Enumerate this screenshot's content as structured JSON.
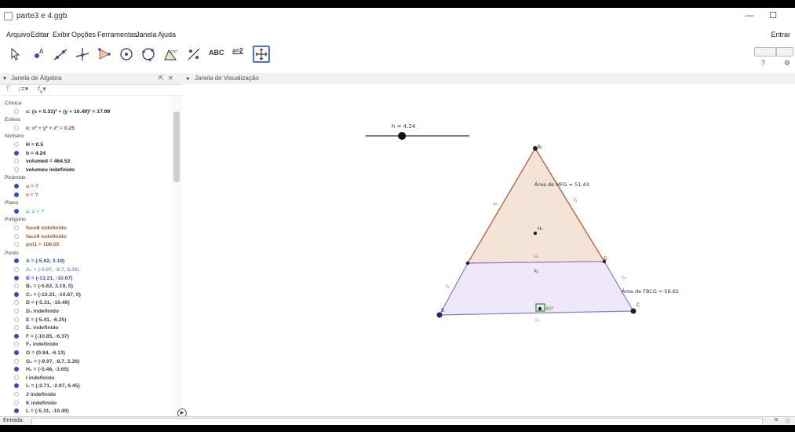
{
  "window": {
    "title": "parte3 e 4.ggb",
    "minimize": "—",
    "maximize": "☐"
  },
  "menu": {
    "items": [
      "Arquivo",
      "Editar",
      "Exibir",
      "Opções",
      "Ferramentas",
      "Janela",
      "Ajuda"
    ],
    "enter": "Entrar"
  },
  "toolbar": {
    "tools": [
      {
        "icon": "move-arrow-icon"
      },
      {
        "icon": "point-icon"
      },
      {
        "icon": "line-icon"
      },
      {
        "icon": "perpendicular-line-icon"
      },
      {
        "icon": "polygon-icon"
      },
      {
        "icon": "circle-center-point-icon"
      },
      {
        "icon": "circle-three-points-icon"
      },
      {
        "icon": "angle-icon"
      },
      {
        "icon": "reflect-icon"
      },
      {
        "icon": "text-icon",
        "label": "ABC"
      },
      {
        "icon": "slider-icon",
        "label": "a=2"
      },
      {
        "icon": "move-graphics-view-icon"
      }
    ],
    "help": "?",
    "active_index": 11
  },
  "algebra_view": {
    "header": "Janela de Álgebra",
    "rows": [
      {
        "type": "cat",
        "text": "Cônica"
      },
      {
        "type": "item",
        "dot": "hollow",
        "text": "c: (x + 5.31)² + (y + 10.49)² = 17.99",
        "color": "#222222"
      },
      {
        "type": "cat",
        "text": "Esfera"
      },
      {
        "type": "item",
        "dot": "hollow",
        "text": "e: x² + y² + z² = 0.25",
        "color": "#b13b2f"
      },
      {
        "type": "cat",
        "text": "Número"
      },
      {
        "type": "item",
        "dot": "hollow",
        "text": "H = 0.5",
        "color": "#222222"
      },
      {
        "type": "item",
        "dot": "filled",
        "text": "h = 4.24",
        "color": "#222222"
      },
      {
        "type": "item",
        "dot": "hollow",
        "text": "volumed = 464.52",
        "color": "#222222"
      },
      {
        "type": "item",
        "dot": "hollow",
        "text": "volumeu indefinido",
        "color": "#222222"
      },
      {
        "type": "cat",
        "text": "Pirâmide"
      },
      {
        "type": "item",
        "dot": "filled",
        "text": "u = ?",
        "color": "#b84b5c"
      },
      {
        "type": "item",
        "dot": "filled",
        "text": "v = ?",
        "color": "#b84b5c"
      },
      {
        "type": "cat",
        "text": "Plano"
      },
      {
        "type": "item",
        "dot": "filled",
        "text": "a: z = ?",
        "color": "#55b7d6"
      },
      {
        "type": "cat",
        "text": "Polígono"
      },
      {
        "type": "item",
        "dot": "hollow",
        "text": "face8 indefinido",
        "color": "#b3582f"
      },
      {
        "type": "item",
        "dot": "hollow",
        "text": "face9 indefinido",
        "color": "#b3582f"
      },
      {
        "type": "item",
        "dot": "hollow",
        "text": "pol1 = 108.05",
        "color": "#b3582f"
      },
      {
        "type": "cat",
        "text": "Ponto"
      },
      {
        "type": "item",
        "dot": "filled",
        "text": "A = (-5.62, 3.19)",
        "color": "#2f4ec8"
      },
      {
        "type": "item",
        "dot": "hollow",
        "text": "A₁ = (-9.97, -8.7, 5.36)",
        "color": "#8f98c8"
      },
      {
        "type": "item",
        "dot": "filled",
        "text": "B = (-13.21, -10.67)",
        "color": "#2f4ec8"
      },
      {
        "type": "item",
        "dot": "hollow",
        "text": "B₁ = (-5.62, 3.19, 0)",
        "color": "#444444"
      },
      {
        "type": "item",
        "dot": "filled",
        "text": "C₁ = (-13.21, -10.67, 0)",
        "color": "#444444"
      },
      {
        "type": "item",
        "dot": "hollow",
        "text": "D = (-5.31, -10.49)",
        "color": "#444444"
      },
      {
        "type": "item",
        "dot": "hollow",
        "text": "D₁ indefinido",
        "color": "#444444"
      },
      {
        "type": "item",
        "dot": "hollow",
        "text": "E = (-5.41, -6.25)",
        "color": "#444444"
      },
      {
        "type": "item",
        "dot": "hollow",
        "text": "E₁ indefinido",
        "color": "#444444"
      },
      {
        "type": "item",
        "dot": "filled",
        "text": "F = (-10.85, -6.37)",
        "color": "#444444"
      },
      {
        "type": "item",
        "dot": "hollow",
        "text": "F₁ indefinido",
        "color": "#444444"
      },
      {
        "type": "item",
        "dot": "filled",
        "text": "G = (0.84, -6.13)",
        "color": "#444444"
      },
      {
        "type": "item",
        "dot": "hollow",
        "text": "G₁ = (-9.97, -8.7, 5.36)",
        "color": "#444444"
      },
      {
        "type": "item",
        "dot": "filled",
        "text": "H₁ = (-5.46, -3.65)",
        "color": "#444444"
      },
      {
        "type": "item",
        "dot": "hollow",
        "text": "I indefinido",
        "color": "#444444"
      },
      {
        "type": "item",
        "dot": "filled",
        "text": "I₁ = (-2.71, -2.97, 6.45)",
        "color": "#444444"
      },
      {
        "type": "item",
        "dot": "hollow",
        "text": "J indefinido",
        "color": "#444444"
      },
      {
        "type": "item",
        "dot": "hollow",
        "text": "K indefinido",
        "color": "#444444"
      },
      {
        "type": "item",
        "dot": "filled",
        "text": "L = (-5.31, -10.49)",
        "color": "#444444"
      }
    ]
  },
  "graphics_view": {
    "header": "Janela de Visualização",
    "slider_label": "h = 4.24",
    "slider_value": 0.35,
    "labels": {
      "apex": "B₁",
      "left_upper": "u₁",
      "right_upper": "f₁",
      "area_top": "Área de  MFG = 51.43",
      "center": "H₁",
      "mid_seg": "u₀",
      "below_mid": "k₁",
      "point_g": "G",
      "c2": "c₂",
      "area_bottom": "Área de  FBCG = 56.62",
      "left_lower": "f₂",
      "point_b": "B",
      "point_c": "C",
      "angle": "90°",
      "bottom_label": "c₂"
    },
    "colors": {
      "upper_fill": "#f4e4d8",
      "upper_stroke": "#b9643b",
      "lower_fill": "#efe8fb",
      "lower_stroke": "#8d78c8",
      "point": "#222222",
      "angle_box": "#2d8a2d"
    }
  },
  "input_bar": {
    "label": "Entrada:",
    "right_symbol": "α"
  }
}
